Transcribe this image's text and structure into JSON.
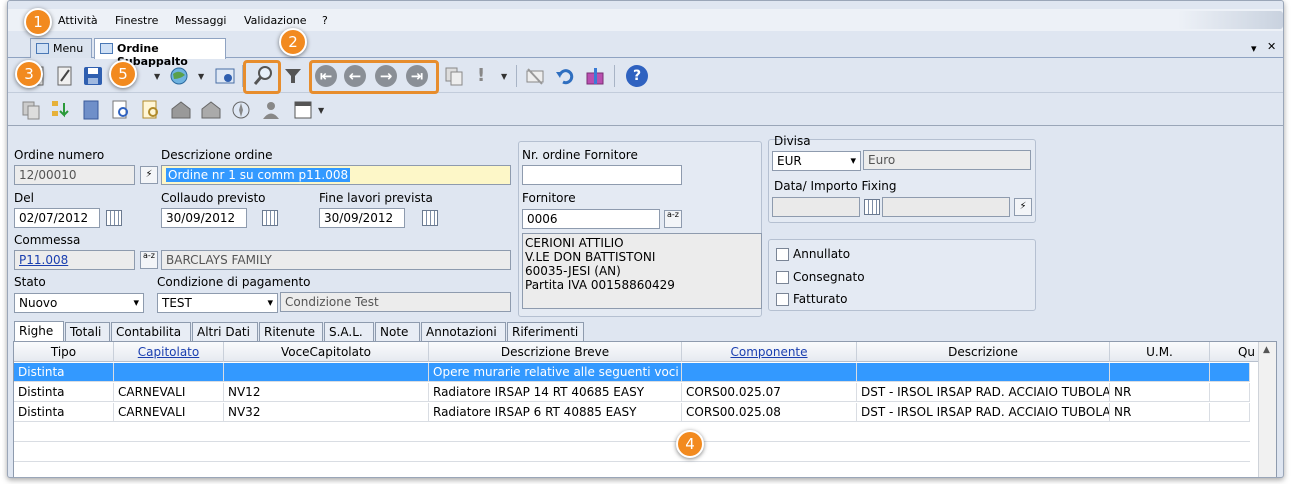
{
  "menu": [
    "Attività",
    "Finestre",
    "Messaggi",
    "Validazione",
    "?"
  ],
  "tabs": [
    {
      "label": "Menu",
      "active": false
    },
    {
      "label": "Ordine Subappalto",
      "active": true
    }
  ],
  "tab_controls": {
    "dropdown": "▾",
    "close": "✕"
  },
  "nav_icons": {
    "first": "⇤",
    "prev": "←",
    "next": "→",
    "last": "⇥"
  },
  "toolbar_misc": {
    "help": "?",
    "warn": "!"
  },
  "form": {
    "ordine_numero": {
      "label": "Ordine numero",
      "value": "12/00010"
    },
    "descrizione": {
      "label": "Descrizione ordine",
      "value": "Ordine nr 1 su comm p11.008"
    },
    "del": {
      "label": "Del",
      "value": "02/07/2012"
    },
    "collaudo": {
      "label": "Collaudo previsto",
      "value": "30/09/2012"
    },
    "fine_lavori": {
      "label": "Fine lavori prevista",
      "value": "30/09/2012"
    },
    "commessa": {
      "label": "Commessa",
      "value": "P11.008",
      "description": "BARCLAYS FAMILY"
    },
    "stato": {
      "label": "Stato",
      "value": "Nuovo"
    },
    "pagamento": {
      "label": "Condizione di pagamento",
      "code": "TEST",
      "description": "Condizione Test"
    },
    "nr_ordine_fornitore": {
      "label": "Nr. ordine Fornitore",
      "value": ""
    },
    "fornitore": {
      "label": "Fornitore",
      "code": "0006",
      "lookup": "a-z",
      "address": [
        "CERIONI ATTILIO",
        "V.LE DON BATTISTONI",
        "60035-JESI (AN)",
        "Partita IVA 00158860429"
      ]
    },
    "divisa": {
      "label": "Divisa",
      "code": "EUR",
      "description": "Euro"
    },
    "fixing": {
      "label": "Data/ Importo Fixing",
      "date": "",
      "importo": ""
    },
    "checks": [
      {
        "label": "Annullato",
        "checked": false
      },
      {
        "label": "Consegnato",
        "checked": false
      },
      {
        "label": "Fatturato",
        "checked": false
      }
    ]
  },
  "bottom_tabs": [
    "Righe",
    "Totali",
    "Contabilita",
    "Altri Dati",
    "Ritenute",
    "S.A.L.",
    "Note",
    "Annotazioni",
    "Riferimenti"
  ],
  "grid": {
    "columns": [
      "Tipo",
      "Capitolato",
      "VoceCapitolato",
      "Descrizione Breve",
      "Componente",
      "Descrizione",
      "U.M.",
      "Qu"
    ],
    "rows": [
      [
        "Distinta",
        "",
        "",
        "Opere murarie relative alle seguenti voci",
        "",
        "",
        "",
        ""
      ],
      [
        "Distinta",
        "CARNEVALI",
        "NV12",
        "Radiatore IRSAP 14 RT 40685 EASY",
        "CORS00.025.07",
        "DST - IRSOL IRSAP RAD. ACCIAIO TUBOLARE",
        "NR",
        ""
      ],
      [
        "Distinta",
        "CARNEVALI",
        "NV32",
        "Radiatore IRSAP 6 RT 40885 EASY",
        "CORS00.025.08",
        "DST - IRSOL IRSAP RAD. ACCIAIO TUBOLARE",
        "NR",
        ""
      ]
    ]
  },
  "callouts": [
    "1",
    "2",
    "3",
    "4",
    "5"
  ],
  "colors": {
    "accent": "#f28a1f",
    "selection": "#3399ff",
    "background": "#dfe6f1"
  }
}
